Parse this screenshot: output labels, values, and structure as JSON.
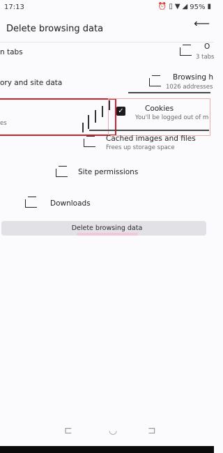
{
  "status_bar": {
    "time": "17:13",
    "battery": "95%",
    "icons": [
      "alarm-icon",
      "vibrate-icon",
      "wifi-icon",
      "signal-icon",
      "battery-icon"
    ]
  },
  "header": {
    "title": "Delete browsing data",
    "back_icon": "back-arrow-icon"
  },
  "options": {
    "open_tabs": {
      "title": "O",
      "left_label": "n tabs",
      "subtitle": "3 tabs"
    },
    "browsing_history": {
      "title": "Browsing h",
      "left_label": "ory and site data",
      "subtitle": "1026 addresses"
    },
    "cookies": {
      "title": "Cookies",
      "left_label": "es",
      "subtitle": "You'll be logged out of most"
    },
    "cached": {
      "title": "Cached images and files",
      "subtitle": "Frees up storage space"
    },
    "site_permissions": {
      "title": "Site permissions"
    },
    "downloads": {
      "title": "Downloads"
    }
  },
  "delete_button": {
    "label": "Delete browsing data"
  },
  "nav_bar": {
    "icons": [
      "recent-apps-icon",
      "home-icon",
      "back-nav-icon"
    ]
  },
  "colors": {
    "highlight_red": "#d0222a",
    "highlight_pink": "#f2a9ae",
    "background": "#fbfbfd"
  }
}
